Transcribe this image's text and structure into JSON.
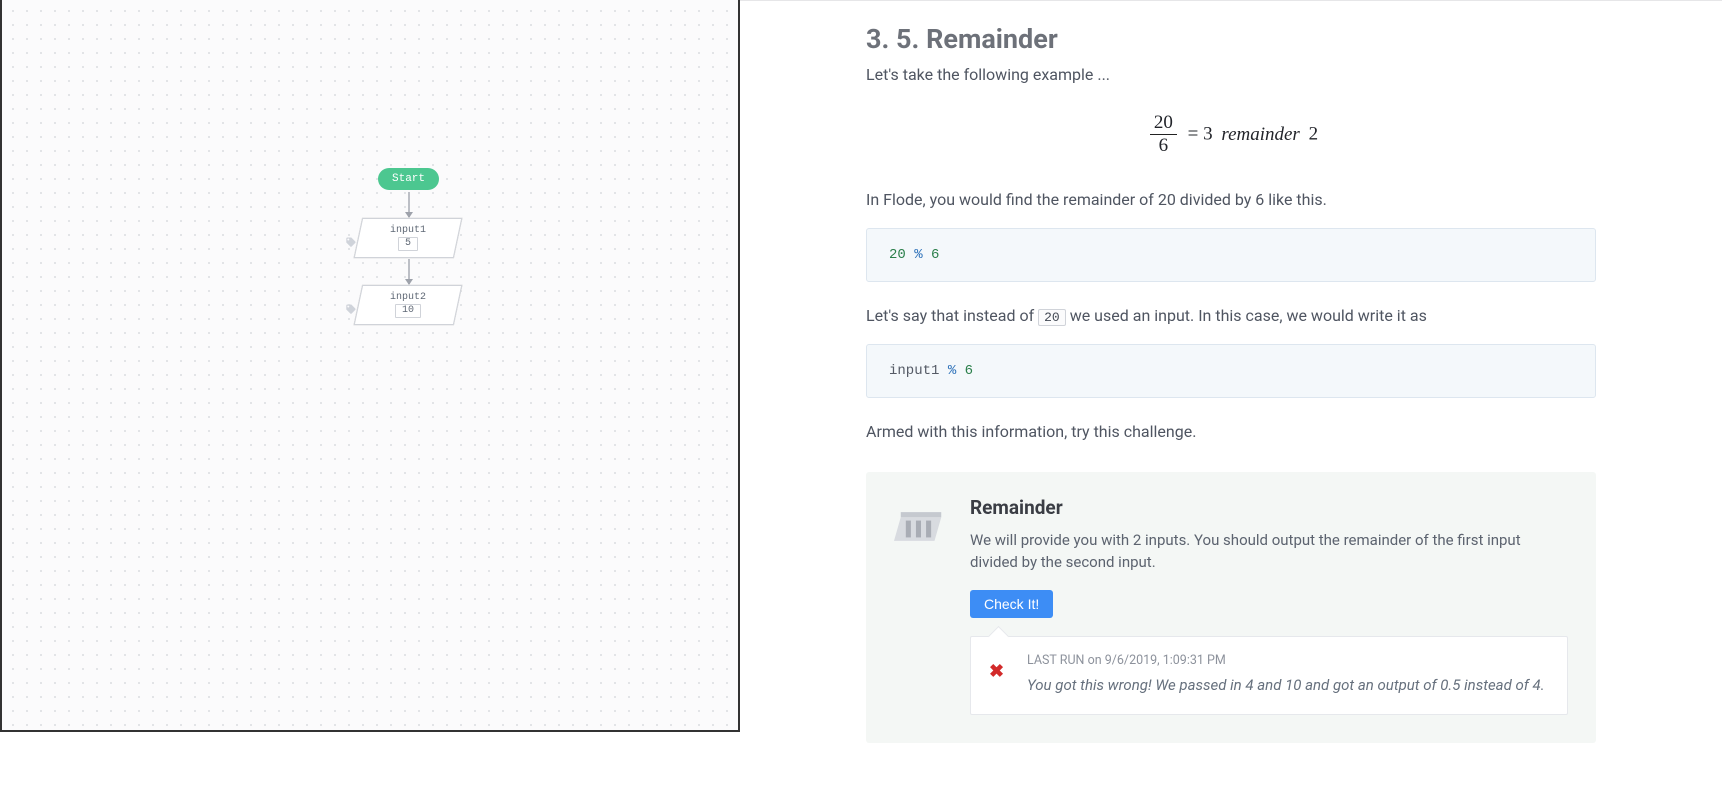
{
  "canvas": {
    "start_label": "Start",
    "nodes": [
      {
        "label": "input1",
        "value": "5"
      },
      {
        "label": "input2",
        "value": "10"
      }
    ]
  },
  "content": {
    "title": "3. 5. Remainder",
    "intro": "Let's take the following example ...",
    "math": {
      "numerator": "20",
      "denominator": "6",
      "equals": "=",
      "quotient": "3",
      "remainder_word": "remainder",
      "remainder_value": "2"
    },
    "para2": "In Flode, you would find the remainder of 20 divided by 6 like this.",
    "code1": {
      "left": "20",
      "op": "%",
      "right": "6"
    },
    "para3_a": "Let's say that instead of ",
    "para3_inline": "20",
    "para3_b": " we used an input. In this case, we would write it as",
    "code2": {
      "left": "input1",
      "op": "%",
      "right": "6"
    },
    "para4": "Armed with this information, try this challenge.",
    "challenge": {
      "title": "Remainder",
      "desc": "We will provide you with 2 inputs. You should output the remainder of the first input divided by the second input.",
      "button": "Check It!",
      "result": {
        "meta_prefix": "LAST RUN on ",
        "meta_time": "9/6/2019, 1:09:31 PM",
        "message": "You got this wrong! We passed in 4 and 10 and got an output of 0.5 instead of 4."
      }
    }
  }
}
